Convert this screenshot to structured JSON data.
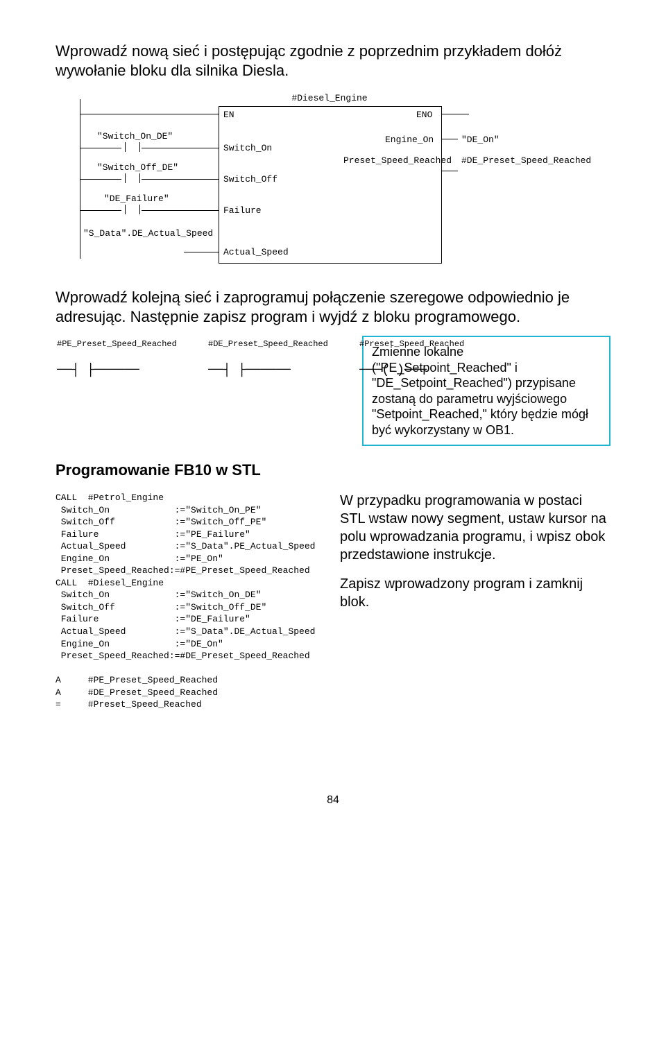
{
  "p1": "Wprowadź nową sieć i postępując zgodnie z poprzednim przykładem dołóż wywołanie bloku dla silnika Diesla.",
  "fbd1": {
    "title": "#Diesel_Engine",
    "en": "EN",
    "eno": "ENO",
    "in1_name": "\"Switch_On_DE\"",
    "in1_port": "Switch_On",
    "in2_name": "\"Switch_Off_DE\"",
    "in2_port": "Switch_Off",
    "in3_name": "\"DE_Failure\"",
    "in3_port": "Failure",
    "in4_name": "\"S_Data\".DE_Actual_Speed",
    "in4_port": "Actual_Speed",
    "out1_port": "Engine_On",
    "out1_name": "\"DE_On\"",
    "out2_port": "Preset_Speed_Reached",
    "out2_name": "#DE_Preset_Speed_Reached"
  },
  "p2": "Wprowadź kolejną sieć i zaprogramuj połączenie szeregowe odpowiednio je adresując. Następnie zapisz program i wyjdź z bloku programowego.",
  "fbd2": {
    "c1": "#PE_Preset_Speed_Reached",
    "c2": "#DE_Preset_Speed_Reached",
    "c3": "#Preset_Speed_Reached"
  },
  "callout": "Zmienne lokalne (\"PE_Setpoint_Reached\" i \"DE_Setpoint_Reached\") przypisane zostaną do parametru wyjściowego \"Setpoint_Reached,\" który będzie mógł być wykorzystany w OB1.",
  "h_stl": "Programowanie FB10 w STL",
  "stl": {
    "l1": "CALL  #Petrol_Engine",
    "l2": " Switch_On            :=\"Switch_On_PE\"",
    "l3": " Switch_Off           :=\"Switch_Off_PE\"",
    "l4": " Failure              :=\"PE_Failure\"",
    "l5": " Actual_Speed         :=\"S_Data\".PE_Actual_Speed",
    "l6": " Engine_On            :=\"PE_On\"",
    "l7": " Preset_Speed_Reached:=#PE_Preset_Speed_Reached",
    "l8": "CALL  #Diesel_Engine",
    "l9": " Switch_On            :=\"Switch_On_DE\"",
    "l10": " Switch_Off           :=\"Switch_Off_DE\"",
    "l11": " Failure              :=\"DE_Failure\"",
    "l12": " Actual_Speed         :=\"S_Data\".DE_Actual_Speed",
    "l13": " Engine_On            :=\"DE_On\"",
    "l14": " Preset_Speed_Reached:=#DE_Preset_Speed_Reached",
    "l15": "",
    "l16": "A     #PE_Preset_Speed_Reached",
    "l17": "A     #DE_Preset_Speed_Reached",
    "l18": "=     #Preset_Speed_Reached"
  },
  "side1": "W przypadku programowania w postaci STL wstaw nowy segment, ustaw kursor na polu wprowadzania programu, i wpisz obok przedstawione instrukcje.",
  "side2": "Zapisz wprowadzony program i zamknij blok.",
  "page": "84"
}
